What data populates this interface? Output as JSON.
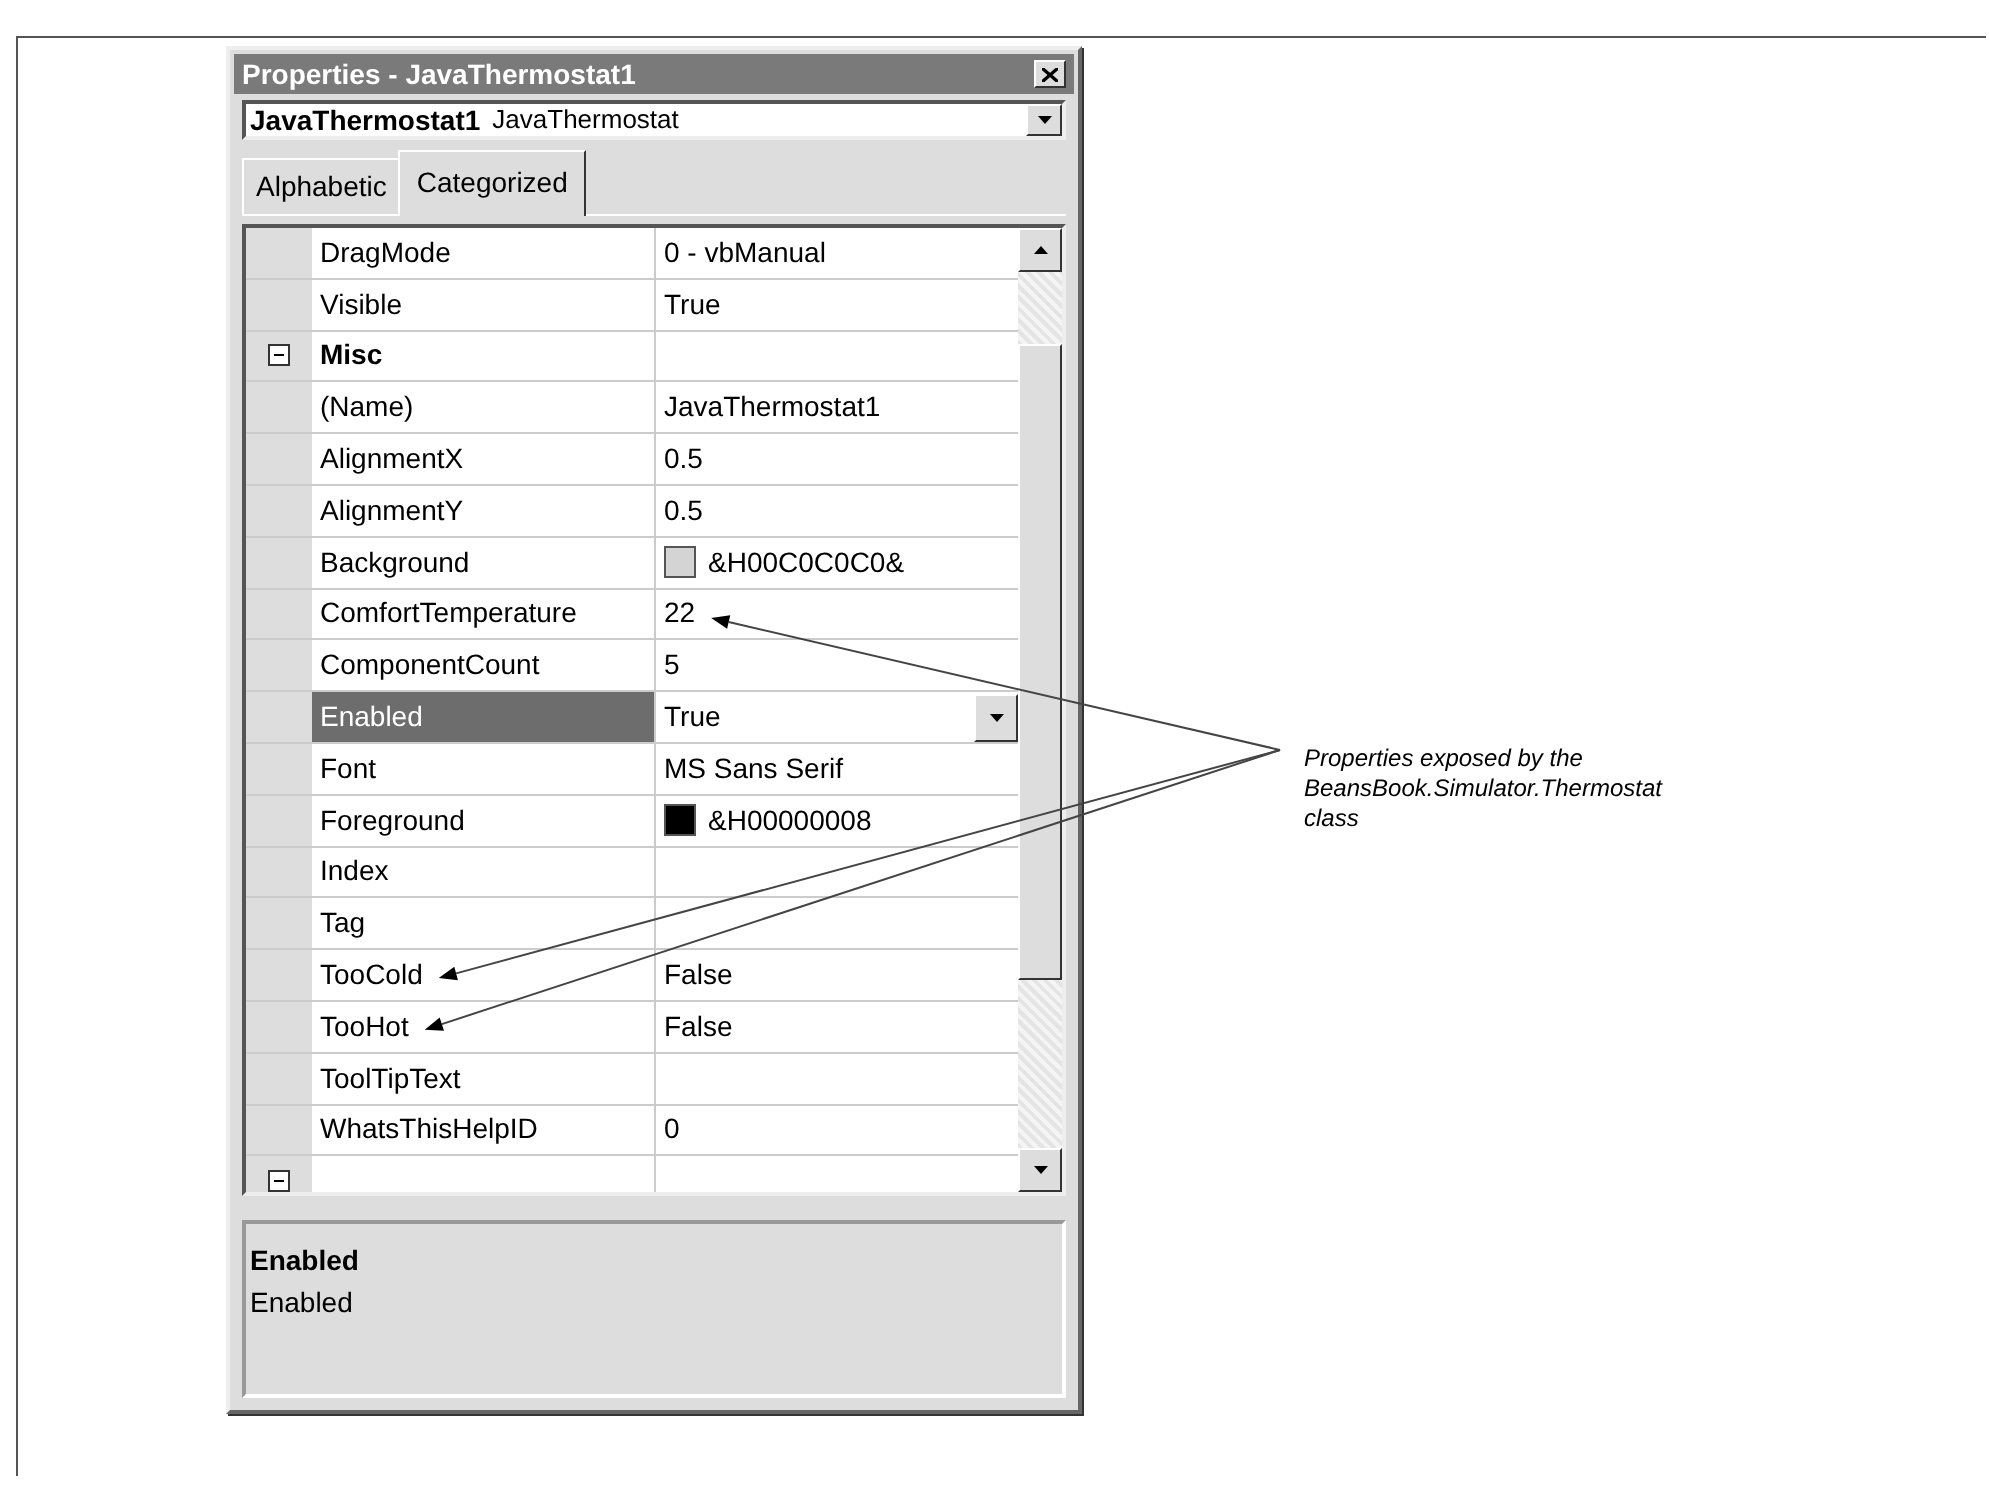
{
  "window": {
    "title": "Properties - JavaThermostat1"
  },
  "object_selector": {
    "name": "JavaThermostat1",
    "type": "JavaThermostat"
  },
  "tabs": [
    {
      "label": "Alphabetic",
      "selected": false
    },
    {
      "label": "Categorized",
      "selected": true
    }
  ],
  "properties": [
    {
      "kind": "property",
      "name": "DragMode",
      "value": "0 - vbManual",
      "selected": false
    },
    {
      "kind": "property",
      "name": "Visible",
      "value": "True",
      "selected": false
    },
    {
      "kind": "category",
      "name": "Misc",
      "expanded": true
    },
    {
      "kind": "property",
      "name": "(Name)",
      "value": "JavaThermostat1",
      "selected": false
    },
    {
      "kind": "property",
      "name": "AlignmentX",
      "value": "0.5",
      "selected": false
    },
    {
      "kind": "property",
      "name": "AlignmentY",
      "value": "0.5",
      "selected": false
    },
    {
      "kind": "property",
      "name": "Background",
      "value": "&H00C0C0C0&",
      "selected": false,
      "color": "#d4d4d4"
    },
    {
      "kind": "property",
      "name": "ComfortTemperature",
      "value": "22",
      "selected": false,
      "value_callout": true
    },
    {
      "kind": "property",
      "name": "ComponentCount",
      "value": "5",
      "selected": false
    },
    {
      "kind": "property",
      "name": "Enabled",
      "value": "True",
      "selected": true
    },
    {
      "kind": "property",
      "name": "Font",
      "value": "MS Sans Serif",
      "selected": false
    },
    {
      "kind": "property",
      "name": "Foreground",
      "value": "&H00000008",
      "selected": false,
      "color": "#000000"
    },
    {
      "kind": "property",
      "name": "Index",
      "selected": false
    },
    {
      "kind": "property",
      "name": "Tag",
      "selected": false
    },
    {
      "kind": "property",
      "name": "TooCold",
      "value": "False",
      "selected": false,
      "name_callout": true
    },
    {
      "kind": "property",
      "name": "TooHot",
      "value": "False",
      "selected": false,
      "name_callout": true
    },
    {
      "kind": "property",
      "name": "ToolTipText",
      "selected": false
    },
    {
      "kind": "property",
      "name": "WhatsThisHelpID",
      "value": "0",
      "selected": false
    },
    {
      "kind": "category",
      "expanded": true
    }
  ],
  "description": {
    "title": "Enabled",
    "text": "Enabled"
  },
  "annotation": {
    "text": "Properties exposed by the BeansBook.Simulator.Thermostat class"
  }
}
